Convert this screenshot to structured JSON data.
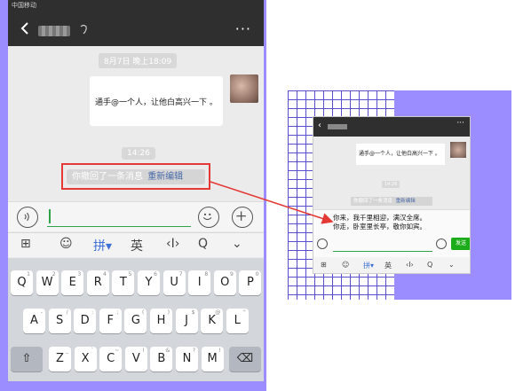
{
  "statusbar": {
    "carrier": "中国移动"
  },
  "chat": {
    "time1": "8月7日 晚上18:09",
    "bubble_text": "通手@一个人，让他白高兴一下 。",
    "time2": "14:26",
    "recall_text": "你撤回了一条消息",
    "reedit_label": "重新编辑"
  },
  "kbtoolbar": {
    "grid": "⊞",
    "smile": "☺",
    "pinyin": "拼▾",
    "english": "英",
    "cursor": "‹I›",
    "search": "Q",
    "hide": "⌄"
  },
  "keyboard": {
    "row1": [
      [
        "Q",
        "1"
      ],
      [
        "W",
        "2"
      ],
      [
        "E",
        "3"
      ],
      [
        "R",
        "4"
      ],
      [
        "T",
        "5"
      ],
      [
        "Y",
        "6"
      ],
      [
        "U",
        "7"
      ],
      [
        "I",
        "8"
      ],
      [
        "O",
        "9"
      ],
      [
        "P",
        "0"
      ]
    ],
    "row2": [
      [
        "A",
        "-"
      ],
      [
        "S",
        "/"
      ],
      [
        "D",
        ":"
      ],
      [
        "F",
        ";"
      ],
      [
        "G",
        "("
      ],
      [
        "H",
        ")"
      ],
      [
        "J",
        "$"
      ],
      [
        "K",
        "@"
      ],
      [
        "L",
        "\""
      ]
    ],
    "row3": [
      [
        "Z",
        "_"
      ],
      [
        "X",
        "`"
      ],
      [
        "C",
        "~"
      ],
      [
        "V",
        "!"
      ],
      [
        "B",
        "&"
      ],
      [
        "N",
        "?"
      ],
      [
        "M",
        "!"
      ]
    ]
  },
  "mini": {
    "bubble_text": "通手@一个人，让他白高兴一下 。",
    "time": "14:26",
    "recall_text": "你撤回了一条消息",
    "reedit_label": "重新编辑",
    "input_text": "你来，我千里相迎，满汉全席。你走，卧室里长亭，敬你如宾。",
    "send_label": "发送",
    "toolbar": [
      "⊞",
      "☺",
      "拼▾",
      "英",
      "‹I›",
      "Q",
      "⌄"
    ]
  },
  "colors": {
    "accent_red": "#e53935",
    "purple": "#9b8cff",
    "green": "#1aad19",
    "link": "#4a6aa8"
  }
}
